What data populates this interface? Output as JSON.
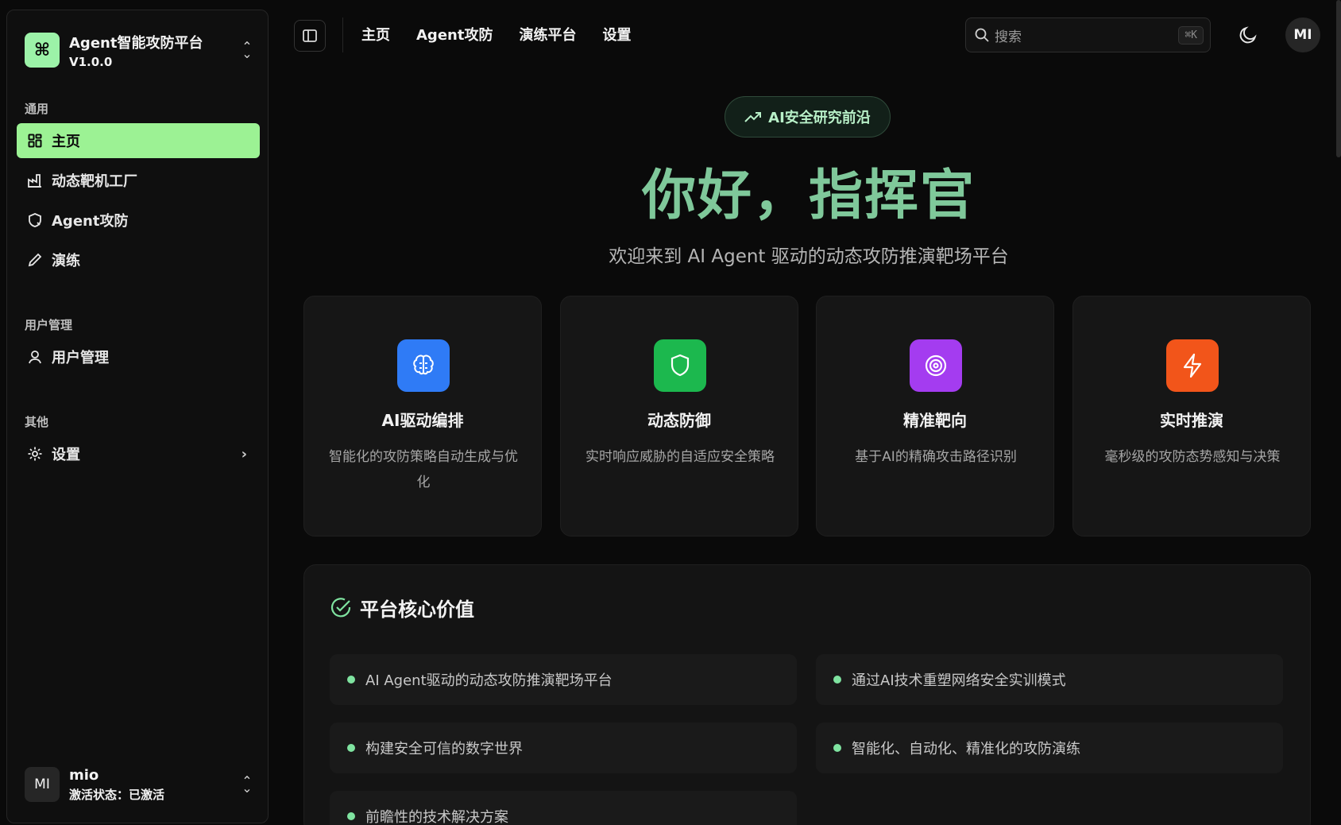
{
  "brand": {
    "name": "Agent智能攻防平台",
    "version": "V1.0.0",
    "logo_icon": "command-icon"
  },
  "sidebar": {
    "groups": [
      {
        "label": "通用"
      },
      {
        "label": "用户管理"
      },
      {
        "label": "其他"
      }
    ],
    "items": [
      {
        "label": "主页",
        "icon": "grid-icon",
        "active": true
      },
      {
        "label": "动态靶机工厂",
        "icon": "factory-icon"
      },
      {
        "label": "Agent攻防",
        "icon": "shield-icon"
      },
      {
        "label": "演练",
        "icon": "pencil-icon"
      },
      {
        "label": "用户管理",
        "icon": "user-icon"
      },
      {
        "label": "设置",
        "icon": "gear-icon"
      }
    ]
  },
  "user": {
    "avatar": "MI",
    "name": "mio",
    "status": "激活状态：已激活"
  },
  "topnav": {
    "items": [
      "主页",
      "Agent攻防",
      "演练平台",
      "设置"
    ]
  },
  "search": {
    "placeholder": "搜索",
    "shortcut": "⌘K"
  },
  "header_avatar": "MI",
  "hero": {
    "pill": "AI安全研究前沿",
    "title": "你好，指挥官",
    "subtitle": "欢迎来到 AI Agent 驱动的动态攻防推演靶场平台"
  },
  "features": [
    {
      "title": "AI驱动编排",
      "desc": "智能化的攻防策略自动生成与优化",
      "icon": "brain-icon",
      "color": "#2f7bf6"
    },
    {
      "title": "动态防御",
      "desc": "实时响应威胁的自适应安全策略",
      "icon": "shield-icon",
      "color": "#1cb84e"
    },
    {
      "title": "精准靶向",
      "desc": "基于AI的精确攻击路径识别",
      "icon": "target-icon",
      "color": "#a43cf0"
    },
    {
      "title": "实时推演",
      "desc": "毫秒级的攻防态势感知与决策",
      "icon": "lightning-icon",
      "color": "#f2551a"
    }
  ],
  "core": {
    "title": "平台核心价值",
    "items": [
      "AI Agent驱动的动态攻防推演靶场平台",
      "通过AI技术重塑网络安全实训模式",
      "构建安全可信的数字世界",
      "智能化、自动化、精准化的攻防演练",
      "前瞻性的技术解决方案"
    ]
  },
  "colors": {
    "accent": "#9cf294",
    "title_green": "#7fc89a",
    "dot": "#7fe3a0"
  }
}
